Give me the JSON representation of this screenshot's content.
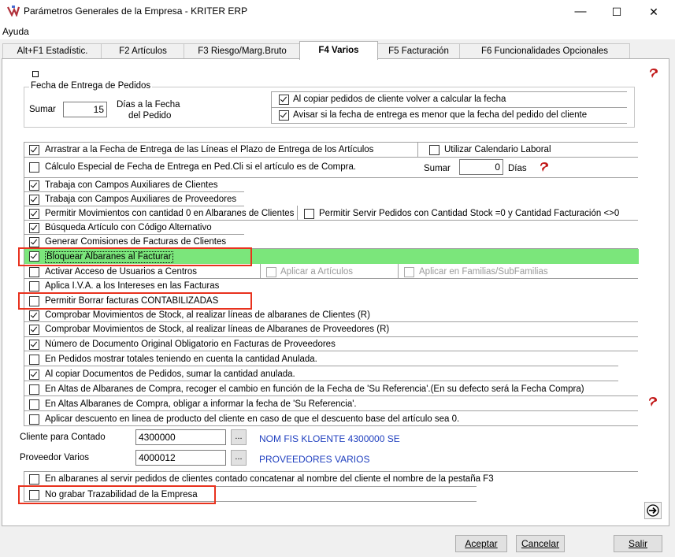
{
  "window": {
    "title": "Parámetros Generales de la Empresa - KRITER ERP",
    "minimize": "—",
    "maximize": "☐",
    "close": "✕"
  },
  "menu": {
    "ayuda": "Ayuda"
  },
  "tabs": [
    {
      "label": "Alt+F1 Estadístic.",
      "active": false
    },
    {
      "label": "F2 Artículos",
      "active": false
    },
    {
      "label": "F3 Riesgo/Marg.Bruto",
      "active": false
    },
    {
      "label": "F4 Varios",
      "active": true
    },
    {
      "label": "F5 Facturación",
      "active": false
    },
    {
      "label": "F6 Funcionalidades Opcionales",
      "active": false
    }
  ],
  "fecha_entrega": {
    "group_title": "Fecha de Entrega de Pedidos",
    "sumar_label": "Sumar",
    "sumar_value": "15",
    "dias_label_1": "Días a la Fecha",
    "dias_label_2": "del Pedido",
    "opt1": "Al copiar pedidos de cliente volver a calcular la fecha",
    "opt1_checked": true,
    "opt2": "Avisar si la fecha de entrega es menor que la fecha del pedido del cliente",
    "opt2_checked": true
  },
  "options": {
    "arrastrar": "Arrastrar a la Fecha de Entrega de las Líneas el Plazo de Entrega de los Artículos",
    "utilizar_calendario": "Utilizar Calendario Laboral",
    "calculo_especial": "Cálculo Especial de Fecha de Entrega en Ped.Cli si el artículo es de Compra.",
    "sumar_label": "Sumar",
    "sumar_value": "0",
    "dias_label": "Días",
    "campos_clientes": "Trabaja con Campos Auxiliares de Clientes",
    "campos_proveedores": "Trabaja con Campos Auxiliares de Proveedores",
    "mov_cantidad_cero": "Permitir Movimientos con cantidad 0 en Albaranes de Clientes",
    "servir_pedidos_stock": "Permitir Servir Pedidos con Cantidad Stock =0 y Cantidad Facturación <>0",
    "busqueda_alternativo": "Búsqueda Artículo con Código Alternativo",
    "generar_comisiones": "Generar Comisiones de Facturas de Clientes",
    "bloquear_albaranes": "Bloquear Albaranes al Facturar",
    "activar_acceso": "Activar Acceso de Usuarios a Centros",
    "aplicar_articulos": "Aplicar a Artículos",
    "aplicar_familias": "Aplicar en Familias/SubFamilias",
    "aplica_iva": "Aplica I.V.A. a los Intereses en las Facturas",
    "permitir_borrar": "Permitir Borrar facturas CONTABILIZADAS",
    "comprobar_clientes": "Comprobar Movimientos de Stock, al realizar líneas de albaranes de Clientes (R)",
    "comprobar_proveedores": "Comprobar Movimientos de Stock, al realizar líneas de Albaranes de Proveedores (R)",
    "numero_documento": "Número de Documento Original Obligatorio en Facturas de Proveedores",
    "pedidos_totales": "En Pedidos mostrar totales teniendo en cuenta la cantidad Anulada.",
    "copiar_documentos": "Al copiar Documentos de Pedidos, sumar la cantidad anulada.",
    "altas_albaranes_cambio": "En Altas de Albaranes de Compra, recoger el cambio en función de la Fecha de 'Su Referencia'.(En su defecto será la Fecha Compra)",
    "altas_albaranes_obligar": "En Altas Albaranes de Compra, obligar a informar la fecha de 'Su Referencia'.",
    "aplicar_descuento": "Aplicar descuento en linea de producto del cliente en caso de que el descuento base del artículo sea 0.",
    "concatenar_nombre": "En albaranes al servir pedidos de clientes contado concatenar al nombre del cliente el nombre de la pestaña F3",
    "no_grabar": "No grabar Trazabilidad de la Empresa"
  },
  "cliente_contado": {
    "label": "Cliente para Contado",
    "value": "4300000",
    "button": "...",
    "name": "NOM FIS KLOENTE 4300000 SE"
  },
  "proveedor_varios": {
    "label": "Proveedor Varios",
    "value": "4000012",
    "button": "...",
    "name": "PROVEEDORES VARIOS"
  },
  "buttons": {
    "aceptar": "Aceptar",
    "cancelar": "Cancelar",
    "salir": "Salir"
  },
  "colors": {
    "highlight_row": "#7be67b",
    "annotation_box": "#e8321e",
    "link_blue": "#1f3fbf"
  }
}
